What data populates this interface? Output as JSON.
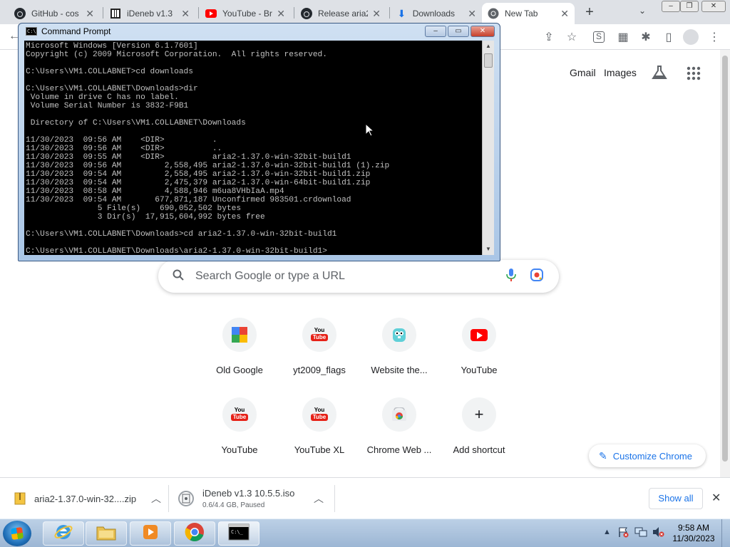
{
  "tabs": [
    {
      "title": "GitHub - cos",
      "icon": "github-icon"
    },
    {
      "title": "iDeneb v1.3",
      "icon": "ideneb-icon"
    },
    {
      "title": "YouTube - Br",
      "icon": "youtube-icon"
    },
    {
      "title": "Release aria2",
      "icon": "github-icon"
    },
    {
      "title": "Downloads",
      "icon": "download-icon"
    },
    {
      "title": "New Tab",
      "icon": "chrome-icon"
    }
  ],
  "window_controls": {
    "minimize": "–",
    "restore": "❐",
    "close": "✕"
  },
  "toolbar": {
    "back": "←",
    "share": "⇪",
    "star": "☆",
    "ext1": "S",
    "ext2": "▦",
    "puzzle": "✱",
    "sidepanel": "▯",
    "menu": "⋮"
  },
  "ntp": {
    "gmail": "Gmail",
    "images": "Images",
    "search_placeholder": "Search Google or type a URL",
    "shortcuts": [
      {
        "label": "Old Google"
      },
      {
        "label": "yt2009_flags"
      },
      {
        "label": "Website the..."
      },
      {
        "label": "YouTube"
      },
      {
        "label": "YouTube"
      },
      {
        "label": "YouTube XL"
      },
      {
        "label": "Chrome Web ..."
      },
      {
        "label": "Add shortcut"
      }
    ],
    "customize": "Customize Chrome"
  },
  "cmd": {
    "title": "Command Prompt",
    "lines": [
      "Microsoft Windows [Version 6.1.7601]",
      "Copyright (c) 2009 Microsoft Corporation.  All rights reserved.",
      "",
      "C:\\Users\\VM1.COLLABNET>cd downloads",
      "",
      "C:\\Users\\VM1.COLLABNET\\Downloads>dir",
      " Volume in drive C has no label.",
      " Volume Serial Number is 3832-F9B1",
      "",
      " Directory of C:\\Users\\VM1.COLLABNET\\Downloads",
      "",
      "11/30/2023  09:56 AM    <DIR>          .",
      "11/30/2023  09:56 AM    <DIR>          ..",
      "11/30/2023  09:55 AM    <DIR>          aria2-1.37.0-win-32bit-build1",
      "11/30/2023  09:56 AM         2,558,495 aria2-1.37.0-win-32bit-build1 (1).zip",
      "11/30/2023  09:54 AM         2,558,495 aria2-1.37.0-win-32bit-build1.zip",
      "11/30/2023  09:54 AM         2,475,379 aria2-1.37.0-win-64bit-build1.zip",
      "11/30/2023  08:58 AM         4,588,946 m6ua8VHbIaA.mp4",
      "11/30/2023  09:54 AM       677,871,187 Unconfirmed 983501.crdownload",
      "               5 File(s)    690,052,502 bytes",
      "               3 Dir(s)  17,915,604,992 bytes free",
      "",
      "C:\\Users\\VM1.COLLABNET\\Downloads>cd aria2-1.37.0-win-32bit-build1",
      "",
      "C:\\Users\\VM1.COLLABNET\\Downloads\\aria2-1.37.0-win-32bit-build1>"
    ]
  },
  "downloads": [
    {
      "name": "aria2-1.37.0-win-32....zip",
      "status": ""
    },
    {
      "name": "iDeneb v1.3 10.5.5.iso",
      "status": "0.6/4.4 GB, Paused"
    }
  ],
  "show_all": "Show all",
  "clock": {
    "time": "9:58 AM",
    "date": "11/30/2023"
  },
  "colors": {
    "accent": "#1a73e8",
    "youtube_red": "#ff0000",
    "cmd_bg": "#000000",
    "cmd_fg": "#c0c0c0"
  }
}
